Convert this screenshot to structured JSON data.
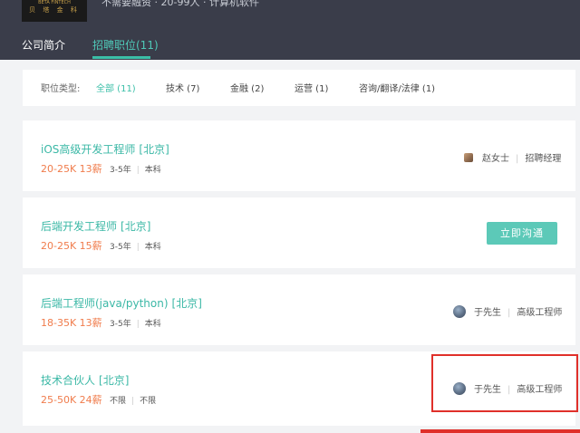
{
  "header": {
    "logo_top": "BETA FINTECH",
    "logo_name": "贝 塔 金 科",
    "company_info": "不需要融资 · 20-99人 · 计算机软件"
  },
  "tabs": [
    {
      "label": "公司简介"
    },
    {
      "label": "招聘职位(11)"
    }
  ],
  "filter": {
    "label": "职位类型:",
    "options": [
      {
        "label": "全部 (11)"
      },
      {
        "label": "技术 (7)"
      },
      {
        "label": "金融 (2)"
      },
      {
        "label": "运营 (1)"
      },
      {
        "label": "咨询/翻译/法律 (1)"
      }
    ]
  },
  "jobs": [
    {
      "title": "iOS高级开发工程师",
      "city": "[北京]",
      "salary": "20-25K 13薪",
      "experience": "3-5年",
      "education": "本科",
      "recruiter_name": "赵女士",
      "recruiter_title": "招聘经理"
    },
    {
      "title": "后端开发工程师",
      "city": "[北京]",
      "salary": "20-25K 15薪",
      "experience": "3-5年",
      "education": "本科",
      "action": "立即沟通"
    },
    {
      "title": "后端工程师(java/python)",
      "city": "[北京]",
      "salary": "18-35K 13薪",
      "experience": "3-5年",
      "education": "本科",
      "recruiter_name": "于先生",
      "recruiter_title": "高级工程师"
    },
    {
      "title": "技术合伙人",
      "city": "[北京]",
      "salary": "25-50K 24薪",
      "experience": "不限",
      "education": "不限",
      "recruiter_name": "于先生",
      "recruiter_title": "高级工程师"
    }
  ],
  "colors": {
    "header_bg": "#3a3d4a",
    "accent": "#3bbfa8",
    "salary": "#f07c4c",
    "button_bg": "#5cc9b8",
    "highlight_border": "#e0302a"
  }
}
